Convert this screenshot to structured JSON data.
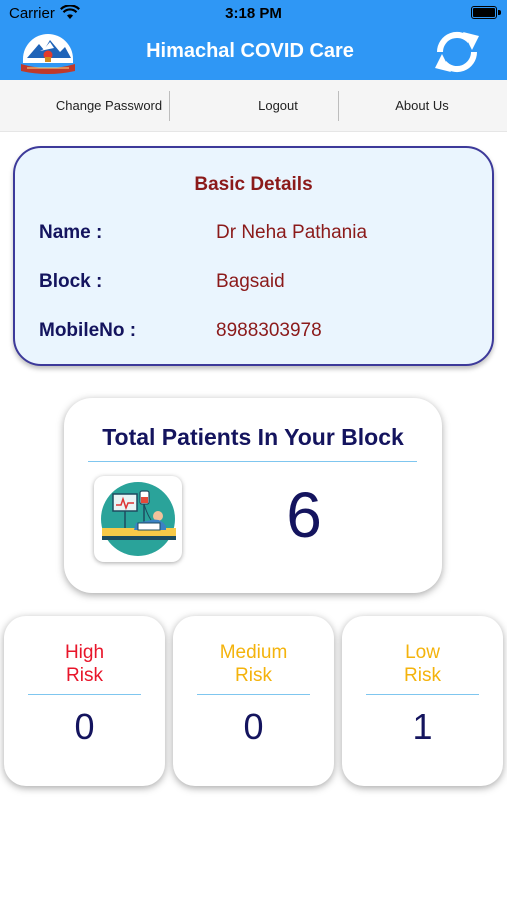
{
  "status_bar": {
    "carrier": "Carrier",
    "time": "3:18 PM"
  },
  "header": {
    "title": "Himachal COVID Care",
    "logo_icon": "himachal-emblem-icon",
    "refresh_icon": "refresh-icon",
    "color": "#2f97f5"
  },
  "menu": {
    "items": [
      {
        "label": "Change Password"
      },
      {
        "label": "Logout"
      },
      {
        "label": "About Us"
      }
    ]
  },
  "details": {
    "title": "Basic Details",
    "name_label": "Name :",
    "name_value": "Dr Neha Pathania",
    "block_label": "Block :",
    "block_value": "Bagsaid",
    "mobile_label": "MobileNo :",
    "mobile_value": "8988303978"
  },
  "total": {
    "title": "Total Patients In Your Block",
    "count": "6",
    "icon": "patient-bed-icon"
  },
  "risk": {
    "high": {
      "line1": "High",
      "line2": "Risk",
      "count": "0",
      "color": "#e8152a"
    },
    "medium": {
      "line1": "Medium",
      "line2": "Risk",
      "count": "0",
      "color": "#f4b30c"
    },
    "low": {
      "line1": "Low",
      "line2": "Risk",
      "count": "1",
      "color": "#f4b30c"
    }
  }
}
